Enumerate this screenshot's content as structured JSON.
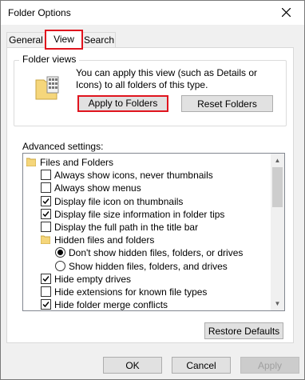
{
  "window": {
    "title": "Folder Options"
  },
  "tabs": [
    {
      "label": "General",
      "active": false
    },
    {
      "label": "View",
      "active": true
    },
    {
      "label": "Search",
      "active": false
    }
  ],
  "folder_views": {
    "group_title": "Folder views",
    "description": "You can apply this view (such as Details or Icons) to all folders of this type.",
    "apply_button": "Apply to Folders",
    "reset_button": "Reset Folders"
  },
  "advanced": {
    "label": "Advanced settings:",
    "items": [
      {
        "type": "folder",
        "label": "Files and Folders"
      },
      {
        "type": "checkbox",
        "label": "Always show icons, never thumbnails",
        "checked": false
      },
      {
        "type": "checkbox",
        "label": "Always show menus",
        "checked": false
      },
      {
        "type": "checkbox",
        "label": "Display file icon on thumbnails",
        "checked": true
      },
      {
        "type": "checkbox",
        "label": "Display file size information in folder tips",
        "checked": true
      },
      {
        "type": "checkbox",
        "label": "Display the full path in the title bar",
        "checked": false
      },
      {
        "type": "folder",
        "label": "Hidden files and folders"
      },
      {
        "type": "radio",
        "label": "Don't show hidden files, folders, or drives",
        "checked": true
      },
      {
        "type": "radio",
        "label": "Show hidden files, folders, and drives",
        "checked": false
      },
      {
        "type": "checkbox",
        "label": "Hide empty drives",
        "checked": true
      },
      {
        "type": "checkbox",
        "label": "Hide extensions for known file types",
        "checked": false
      },
      {
        "type": "checkbox",
        "label": "Hide folder merge conflicts",
        "checked": true
      }
    ]
  },
  "restore_button": "Restore Defaults",
  "footer": {
    "ok": "OK",
    "cancel": "Cancel",
    "apply": "Apply"
  },
  "colors": {
    "highlight": "#e0141e",
    "folder": "#f5d67b"
  }
}
